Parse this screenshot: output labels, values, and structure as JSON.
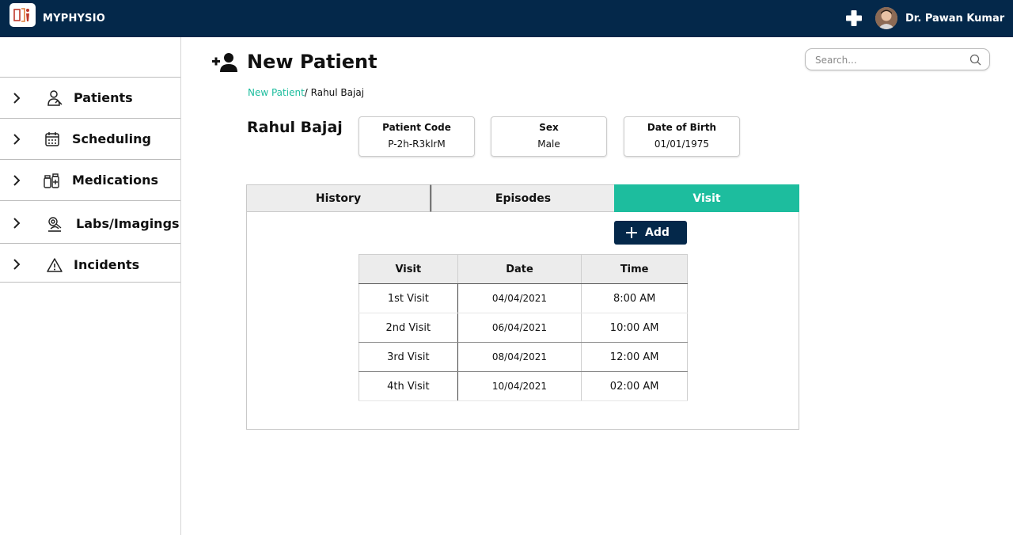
{
  "app": {
    "title": "MYPHYSIO",
    "brand_color": "#04284a",
    "accent_color": "#1dbd9e"
  },
  "header": {
    "user_name": "Dr. Pawan Kumar",
    "add_icon": "plus-icon",
    "avatar_icon": "user-avatar"
  },
  "sidebar": {
    "items": [
      {
        "label": "Patients",
        "icon": "patient-icon"
      },
      {
        "label": "Scheduling",
        "icon": "calendar-icon"
      },
      {
        "label": "Medications",
        "icon": "medication-icon"
      },
      {
        "label": "Labs/Imagings",
        "icon": "microscope-icon"
      },
      {
        "label": "Incidents",
        "icon": "warning-icon"
      }
    ]
  },
  "page": {
    "title": "New Patient",
    "breadcrumb": {
      "link": "New Patient",
      "current": "/ Rahul Bajaj"
    }
  },
  "search": {
    "placeholder": "Search..."
  },
  "patient": {
    "name": "Rahul Bajaj",
    "code_label": "Patient Code",
    "code_value": "P-2h-R3klrM",
    "sex_label": "Sex",
    "sex_value": "Male",
    "dob_label": "Date of Birth",
    "dob_value": "01/01/1975"
  },
  "tabs": [
    {
      "label": "History",
      "active": false
    },
    {
      "label": "Episodes",
      "active": false
    },
    {
      "label": "Visit",
      "active": true
    }
  ],
  "visit": {
    "add_label": "Add",
    "columns": [
      "Visit",
      "Date",
      "Time"
    ],
    "rows": [
      {
        "visit": "1st Visit",
        "date": "04/04/2021",
        "time": "8:00 AM"
      },
      {
        "visit": "2nd Visit",
        "date": "06/04/2021",
        "time": "10:00 AM"
      },
      {
        "visit": "3rd Visit",
        "date": "08/04/2021",
        "time": "12:00 AM"
      },
      {
        "visit": "4th Visit",
        "date": "10/04/2021",
        "time": "02:00 AM"
      }
    ]
  }
}
